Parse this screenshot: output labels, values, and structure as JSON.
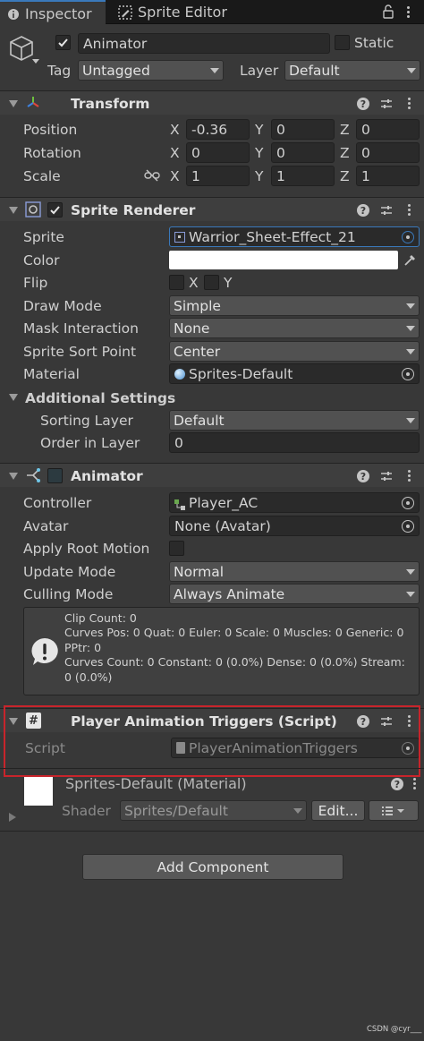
{
  "tabs": [
    {
      "label": "Inspector",
      "icon": "inspector-icon"
    },
    {
      "label": "Sprite Editor",
      "icon": "sprite-editor-icon"
    }
  ],
  "header": {
    "object_name": "Animator",
    "static_label": "Static",
    "tag_label": "Tag",
    "tag_value": "Untagged",
    "layer_label": "Layer",
    "layer_value": "Default"
  },
  "transform": {
    "title": "Transform",
    "position_label": "Position",
    "rotation_label": "Rotation",
    "scale_label": "Scale",
    "axis_x": "X",
    "axis_y": "Y",
    "axis_z": "Z",
    "position": {
      "x": "-0.36",
      "y": "0",
      "z": "0"
    },
    "rotation": {
      "x": "0",
      "y": "0",
      "z": "0"
    },
    "scale": {
      "x": "1",
      "y": "1",
      "z": "1"
    }
  },
  "sprite_renderer": {
    "title": "Sprite Renderer",
    "sprite_label": "Sprite",
    "sprite_value": "Warrior_Sheet-Effect_21",
    "color_label": "Color",
    "color_value": "#ffffff",
    "flip_label": "Flip",
    "flip_x": "X",
    "flip_y": "Y",
    "draw_mode_label": "Draw Mode",
    "draw_mode_value": "Simple",
    "mask_label": "Mask Interaction",
    "mask_value": "None",
    "sort_point_label": "Sprite Sort Point",
    "sort_point_value": "Center",
    "material_label": "Material",
    "material_value": "Sprites-Default",
    "additional_label": "Additional Settings",
    "sorting_layer_label": "Sorting Layer",
    "sorting_layer_value": "Default",
    "order_label": "Order in Layer",
    "order_value": "0"
  },
  "animator": {
    "title": "Animator",
    "controller_label": "Controller",
    "controller_value": "Player_AC",
    "avatar_label": "Avatar",
    "avatar_value": "None (Avatar)",
    "root_motion_label": "Apply Root Motion",
    "update_mode_label": "Update Mode",
    "update_mode_value": "Normal",
    "culling_label": "Culling Mode",
    "culling_value": "Always Animate",
    "info_line1": "Clip Count: 0",
    "info_line2": "Curves Pos: 0 Quat: 0 Euler: 0 Scale: 0 Muscles: 0 Generic: 0",
    "info_line3": "PPtr: 0",
    "info_line4": "Curves Count: 0 Constant: 0 (0.0%) Dense: 0 (0.0%) Stream:",
    "info_line5": "0 (0.0%)"
  },
  "script_component": {
    "title": "Player Animation Triggers (Script)",
    "script_label": "Script",
    "script_value": "PlayerAnimationTriggers"
  },
  "material": {
    "title": "Sprites-Default (Material)",
    "shader_label": "Shader",
    "shader_value": "Sprites/Default",
    "edit_button": "Edit..."
  },
  "add_component_button": "Add Component",
  "watermark": "CSDN @cyr___",
  "colors": {
    "background": "#383838",
    "highlight_border": "#c8242b",
    "tab_accent": "#3a79bb"
  }
}
